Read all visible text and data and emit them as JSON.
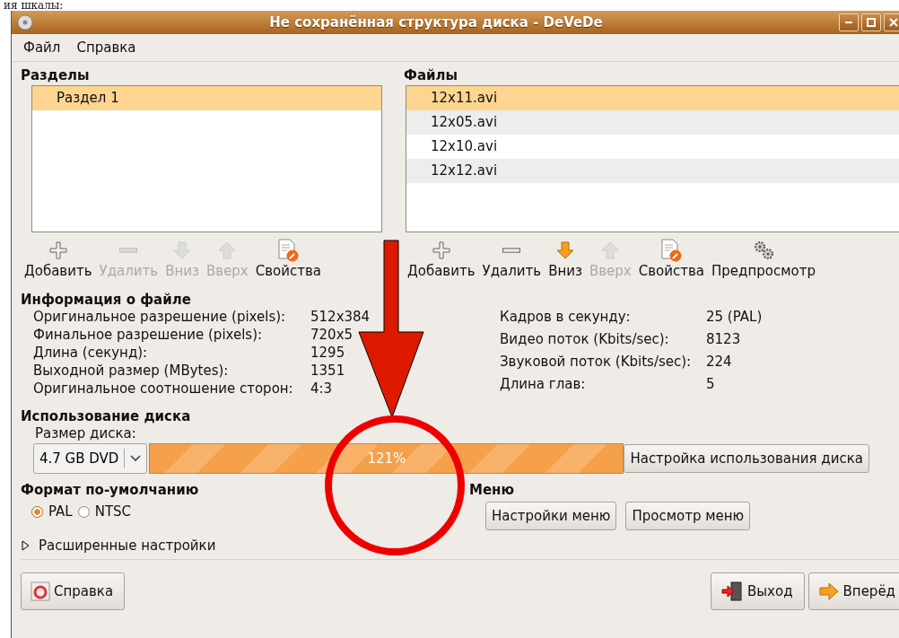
{
  "page_caption": "ия шкалы:",
  "window": {
    "title": "Не сохранённая структура диска - DeVeDe"
  },
  "menu": [
    {
      "label": "Файл"
    },
    {
      "label": "Справка"
    }
  ],
  "partitions": {
    "title": "Разделы",
    "items": [
      {
        "label": "Раздел 1",
        "selected": true
      }
    ],
    "toolbar": [
      {
        "kind": "add",
        "label": "Добавить",
        "disabled": false
      },
      {
        "kind": "remove",
        "label": "Удалить",
        "disabled": true
      },
      {
        "kind": "down",
        "label": "Вниз",
        "disabled": true
      },
      {
        "kind": "up",
        "label": "Вверх",
        "disabled": true
      },
      {
        "kind": "properties",
        "label": "Свойства",
        "disabled": false
      }
    ]
  },
  "files": {
    "title": "Файлы",
    "items": [
      {
        "label": "12x11.avi",
        "selected": true
      },
      {
        "label": "12x05.avi",
        "selected": false
      },
      {
        "label": "12x10.avi",
        "selected": false
      },
      {
        "label": "12x12.avi",
        "selected": false
      }
    ],
    "toolbar": [
      {
        "kind": "add",
        "label": "Добавить",
        "disabled": false
      },
      {
        "kind": "remove",
        "label": "Удалить",
        "disabled": false
      },
      {
        "kind": "down",
        "label": "Вниз",
        "disabled": false
      },
      {
        "kind": "up",
        "label": "Вверх",
        "disabled": true
      },
      {
        "kind": "properties",
        "label": "Свойства",
        "disabled": false
      },
      {
        "kind": "preview",
        "label": "Предпросмотр",
        "disabled": false
      }
    ]
  },
  "file_info": {
    "title": "Информация о файле",
    "left": [
      {
        "label": "Оригинальное разрешение (pixels):",
        "value": "512x384"
      },
      {
        "label": "Финальное разрешение (pixels):",
        "value": "720x5"
      },
      {
        "label": "Длина (секунд):",
        "value": "1295"
      },
      {
        "label": "Выходной размер (MBytes):",
        "value": "1351"
      },
      {
        "label": "Оригинальное соотношение сторон:",
        "value": "4:3"
      }
    ],
    "right": [
      {
        "label": "Кадров в секунду:",
        "value": "25 (PAL)"
      },
      {
        "label": "Видео поток (Kbits/sec):",
        "value": "8123"
      },
      {
        "label": "Звуковой поток (Kbits/sec):",
        "value": "224"
      },
      {
        "label": "Длина глав:",
        "value": "5"
      }
    ]
  },
  "disk_usage": {
    "title": "Использование диска",
    "size_label": "Размер диска:",
    "size_value": "4.7 GB DVD",
    "level": 1,
    "reading": "121%",
    "settings_button": "Настройка использования диска"
  },
  "default_format": {
    "title": "Формат по-умолчанию",
    "options": [
      {
        "label": "PAL",
        "selected": true
      },
      {
        "label": "NTSC",
        "selected": false
      }
    ]
  },
  "menu_section": {
    "title": "Меню",
    "buttons": [
      "Настройки меню",
      "Просмотр меню"
    ]
  },
  "advanced": {
    "label": "Расширенные настройки",
    "expanded": false
  },
  "footer": {
    "help": "Справка",
    "quit": "Выход",
    "next": "Вперёд"
  }
}
